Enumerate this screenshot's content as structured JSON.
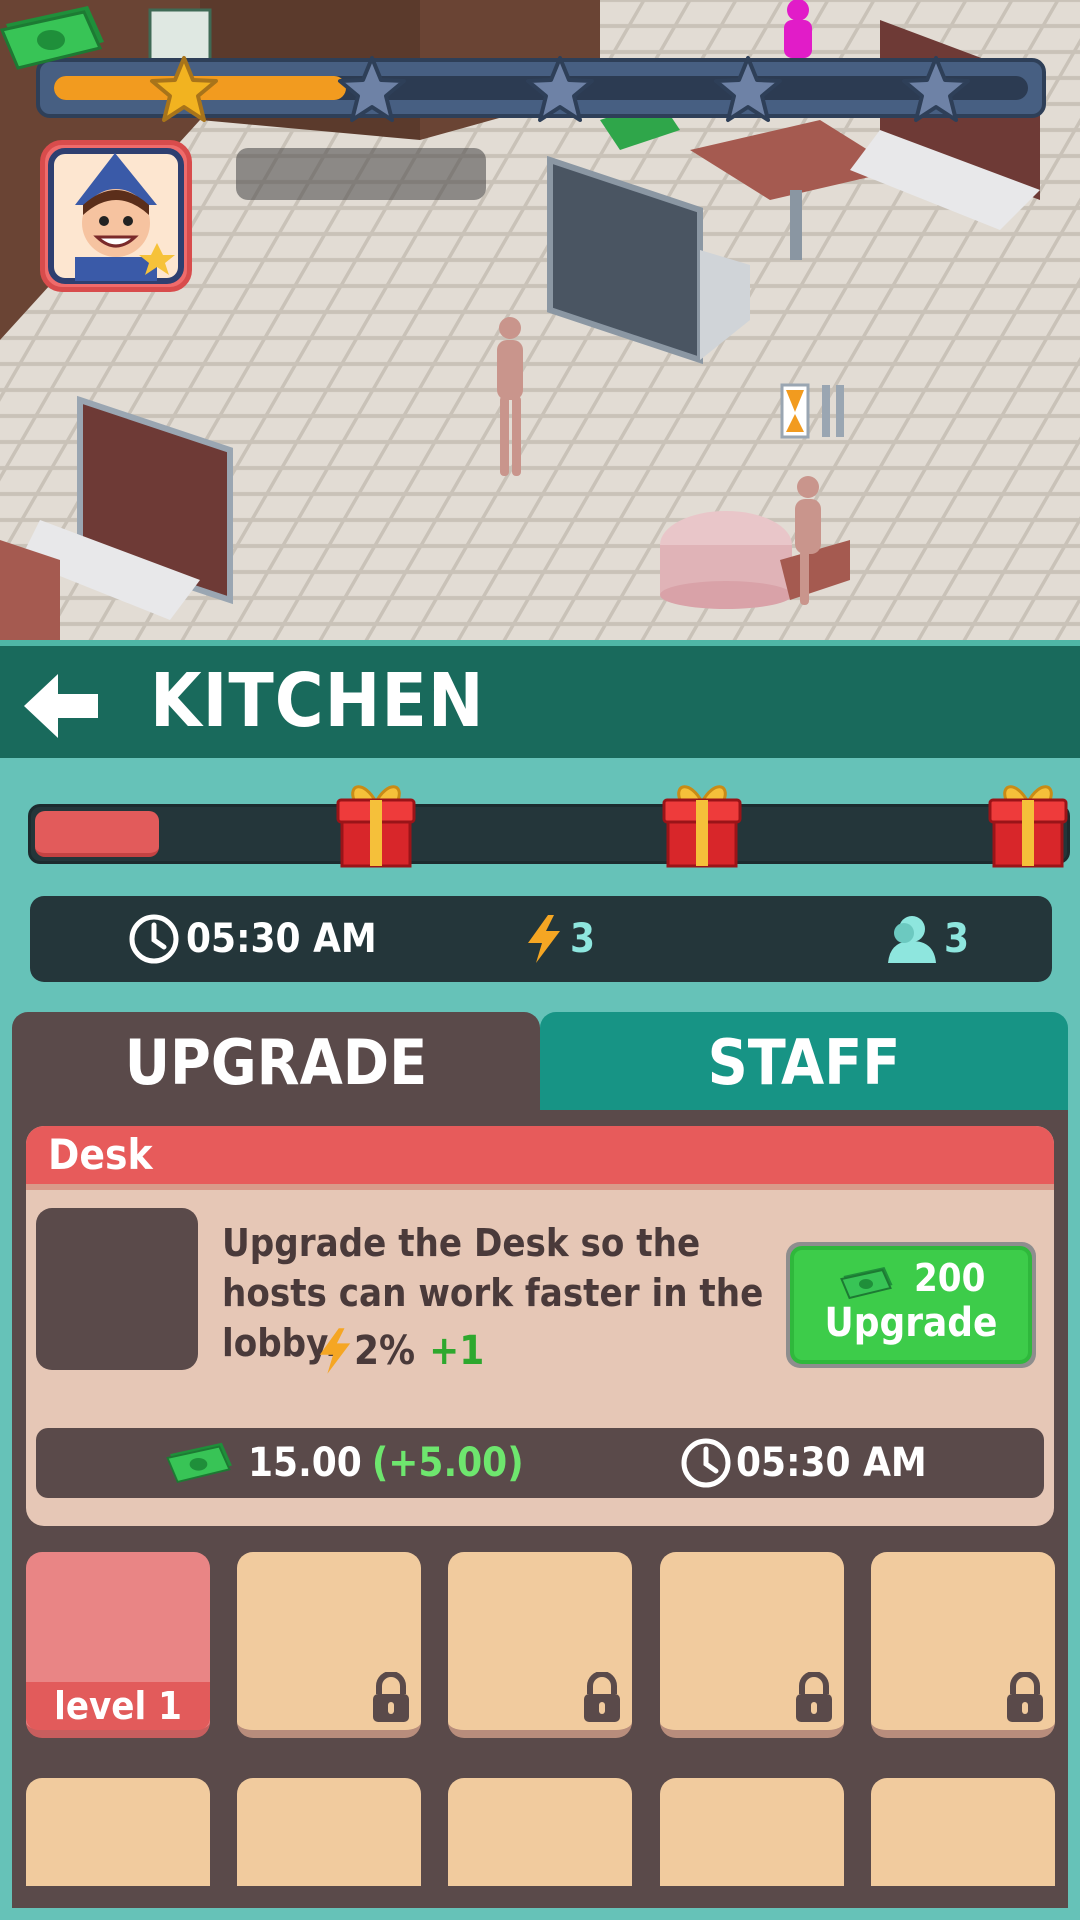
{
  "hud": {
    "star_progress": 0.3,
    "stars": [
      {
        "achieved": true
      },
      {
        "achieved": false
      },
      {
        "achieved": false
      },
      {
        "achieved": false
      },
      {
        "achieved": false
      }
    ],
    "money_value": ""
  },
  "header": {
    "title": "KITCHEN"
  },
  "milestone": {
    "progress": 0.12,
    "gifts": 3
  },
  "info": {
    "time": "05:30 AM",
    "energy": "3",
    "staff_count": "3"
  },
  "tabs": [
    {
      "label": "UPGRADE",
      "active": true
    },
    {
      "label": "STAFF",
      "active": false
    }
  ],
  "upgrade_card": {
    "name": "Desk",
    "description": "Upgrade the Desk so the hosts can work faster in the lobby.",
    "stat_value": "2%",
    "stat_bonus": "+1",
    "button": {
      "price": "200",
      "label": "Upgrade"
    },
    "income": "15.00",
    "income_bonus": "(+5.00)",
    "time": "05:30 AM"
  },
  "levels": [
    {
      "label": "level 1",
      "locked": false
    },
    {
      "label": "",
      "locked": true
    },
    {
      "label": "",
      "locked": true
    },
    {
      "label": "",
      "locked": true
    },
    {
      "label": "",
      "locked": true
    }
  ],
  "colors": {
    "panel_teal": "#66c2b8",
    "header_teal": "#196a5c",
    "card_red": "#e75b5b",
    "upgrade_green": "#3dcc4a"
  }
}
